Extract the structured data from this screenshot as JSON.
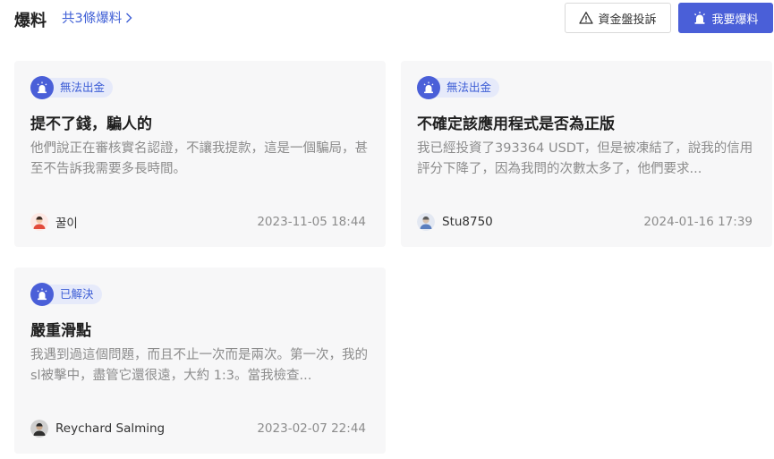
{
  "header": {
    "title": "爆料",
    "count_link": "共3條爆料",
    "complaint_button": "資金盤投訴",
    "report_button": "我要爆料"
  },
  "colors": {
    "accent": "#4a5fd8",
    "tag_bg": "#e6eafa",
    "card_bg": "#f7f7f8",
    "muted_text": "#8c8c8c"
  },
  "cards": [
    {
      "tag": "無法出金",
      "tag_icon": "alarm-icon",
      "title": "提不了錢，騙人的",
      "description": "他們說正在審核實名認證，不讓我提款，這是一個騙局，甚至不告訴我需要多長時間。",
      "author": "꿀이",
      "avatar_icon": "avatar-red-icon",
      "date": "2023-11-05 18:44"
    },
    {
      "tag": "無法出金",
      "tag_icon": "alarm-icon",
      "title": "不確定該應用程式是否為正版",
      "description": "我已經投資了393364 USDT，但是被凍結了，說我的信用評分下降了，因為我問的次數太多了，他們要求...",
      "author": "Stu8750",
      "avatar_icon": "avatar-blue-icon",
      "date": "2024-01-16 17:39"
    },
    {
      "tag": "已解決",
      "tag_icon": "alarm-icon",
      "title": "嚴重滑點",
      "description": "我遇到過這個問題，而且不止一次而是兩次。第一次，我的sl被擊中，盡管它還很遠，大約 1:3。當我檢查...",
      "author": "Reychard Salming",
      "avatar_icon": "avatar-dark-icon",
      "date": "2023-02-07 22:44"
    }
  ]
}
